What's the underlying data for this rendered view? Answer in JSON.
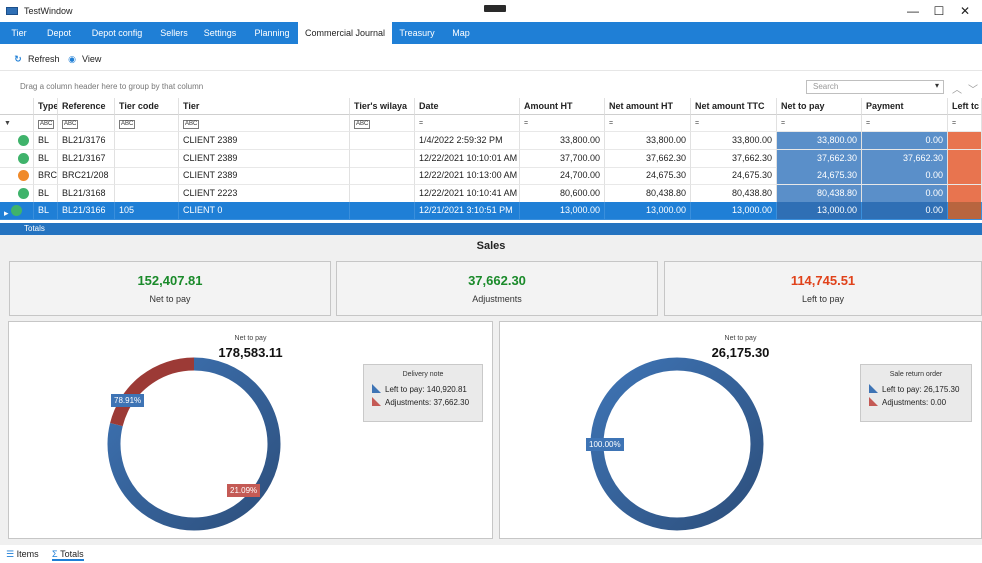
{
  "window": {
    "title": "TestWindow",
    "min": "—",
    "max": "☐",
    "close": "✕"
  },
  "nav": {
    "tabs": [
      "Tier",
      "Depot",
      "Depot config",
      "Sellers",
      "Settings",
      "Planning",
      "Commercial Journal",
      "Treasury",
      "Map"
    ],
    "active_index": 6
  },
  "toolbar": {
    "refresh": "Refresh",
    "view": "View"
  },
  "grid": {
    "group_hint": "Drag a column header here to group by that column",
    "search_placeholder": "Search",
    "columns": [
      "Type",
      "Reference",
      "Tier code",
      "Tier",
      "Tier's wilaya",
      "Date",
      "Amount HT",
      "Net amount HT",
      "Net amount TTC",
      "Net to pay",
      "Payment",
      "Left tc"
    ],
    "filter_text_tag": "ABC",
    "filter_eq": "=",
    "rows": [
      {
        "status": "ok",
        "type": "BL",
        "reference": "BL21/3176",
        "tier_code": "",
        "tier": "CLIENT 2389",
        "wilaya": "",
        "date": "1/4/2022 2:59:32 PM",
        "amount_ht": "33,800.00",
        "net_ht": "33,800.00",
        "net_ttc": "33,800.00",
        "net_to_pay": "33,800.00",
        "payment": "0.00"
      },
      {
        "status": "ok",
        "type": "BL",
        "reference": "BL21/3167",
        "tier_code": "",
        "tier": "CLIENT 2389",
        "wilaya": "",
        "date": "12/22/2021 10:10:01 AM",
        "amount_ht": "37,700.00",
        "net_ht": "37,662.30",
        "net_ttc": "37,662.30",
        "net_to_pay": "37,662.30",
        "payment": "37,662.30"
      },
      {
        "status": "warn",
        "type": "BRC",
        "reference": "BRC21/208",
        "tier_code": "",
        "tier": "CLIENT 2389",
        "wilaya": "",
        "date": "12/22/2021 10:13:00 AM",
        "amount_ht": "24,700.00",
        "net_ht": "24,675.30",
        "net_ttc": "24,675.30",
        "net_to_pay": "24,675.30",
        "payment": "0.00"
      },
      {
        "status": "ok",
        "type": "BL",
        "reference": "BL21/3168",
        "tier_code": "",
        "tier": "CLIENT 2223",
        "wilaya": "",
        "date": "12/22/2021 10:10:41 AM",
        "amount_ht": "80,600.00",
        "net_ht": "80,438.80",
        "net_ttc": "80,438.80",
        "net_to_pay": "80,438.80",
        "payment": "0.00"
      },
      {
        "status": "ok",
        "type": "BL",
        "reference": "BL21/3166",
        "tier_code": "105",
        "tier": "CLIENT 0",
        "wilaya": "",
        "date": "12/21/2021 3:10:51 PM",
        "amount_ht": "13,000.00",
        "net_ht": "13,000.00",
        "net_ttc": "13,000.00",
        "net_to_pay": "13,000.00",
        "payment": "0.00"
      }
    ],
    "selected_row": 4,
    "totals_label": "Totals"
  },
  "sales": {
    "title": "Sales",
    "kpis": [
      {
        "value": "152,407.81",
        "label": "Net to pay",
        "color": "#1a8a2a"
      },
      {
        "value": "37,662.30",
        "label": "Adjustments",
        "color": "#1a8a2a"
      },
      {
        "value": "114,745.51",
        "label": "Left to pay",
        "color": "#e0421a"
      }
    ],
    "delivery": {
      "caption": "Net to pay",
      "total": "178,583.11",
      "legend_title": "Delivery note",
      "left_label": "Left to pay: 140,920.81",
      "adj_label": "Adjustments: 37,662.30",
      "left_pct_label": "78.91%",
      "adj_pct_label": "21.09%",
      "left_fraction": 0.7891,
      "adj_fraction": 0.2109
    },
    "returns": {
      "caption": "Net to pay",
      "total": "26,175.30",
      "legend_title": "Sale return order",
      "left_label": "Left to pay: 26,175.30",
      "adj_label": "Adjustments: 0.00",
      "left_pct_label": "100.00%",
      "left_fraction": 1.0,
      "adj_fraction": 0.0
    },
    "colors": {
      "left": "#3e74b5",
      "left_dark": "#2d4f7c",
      "adj": "#9c3a36",
      "adj_label": "#c45a55"
    }
  },
  "bottom_tabs": {
    "items": "Items",
    "totals": "Totals"
  }
}
